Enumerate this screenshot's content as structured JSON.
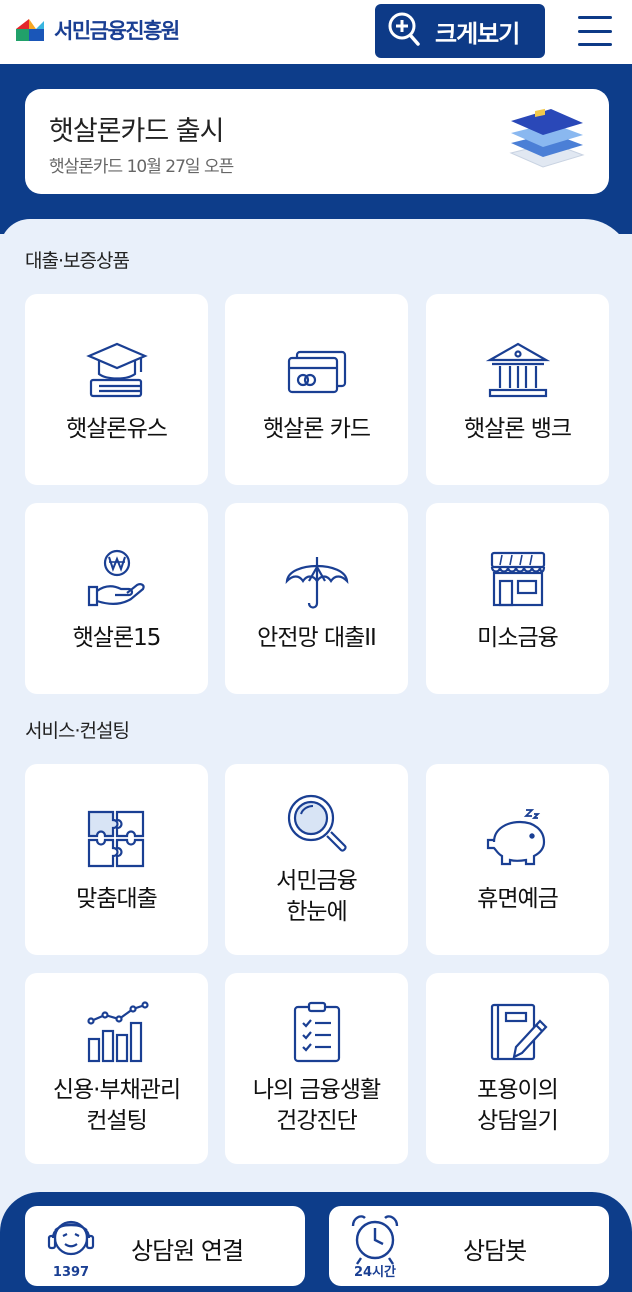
{
  "header": {
    "logo_text": "서민금융진흥원",
    "zoom_label": "크게보기"
  },
  "banner": {
    "title": "햇살론카드 출시",
    "subtitle": "햇살론카드 10월 27일 오픈"
  },
  "sections": {
    "loans_title": "대출·보증상품",
    "services_title": "서비스·컨설팅"
  },
  "loans": [
    {
      "label": "햇살론유스",
      "icon": "graduation-cap-icon"
    },
    {
      "label": "햇살론 카드",
      "icon": "credit-card-icon"
    },
    {
      "label": "햇살론 뱅크",
      "icon": "bank-building-icon"
    },
    {
      "label": "햇살론15",
      "icon": "hand-won-coin-icon"
    },
    {
      "label": "안전망 대출II",
      "icon": "umbrella-icon"
    },
    {
      "label": "미소금융",
      "icon": "storefront-icon"
    }
  ],
  "services": [
    {
      "label": "맞춤대출",
      "icon": "puzzle-icon"
    },
    {
      "label": "서민금융\n한눈에",
      "icon": "magnifier-icon"
    },
    {
      "label": "휴면예금",
      "icon": "piggy-bank-icon"
    },
    {
      "label": "신용·부채관리\n컨설팅",
      "icon": "bar-chart-icon"
    },
    {
      "label": "나의 금융생활\n건강진단",
      "icon": "checklist-clipboard-icon"
    },
    {
      "label": "포용이의\n상담일기",
      "icon": "notebook-pen-icon"
    }
  ],
  "bottom": {
    "counsel_label": "상담원 연결",
    "counsel_badge": "1397",
    "bot_label": "상담봇",
    "bot_badge": "24시간"
  },
  "colors": {
    "primary": "#0d3d8a",
    "background": "#e9f0fa",
    "icon_stroke": "#1a3f93"
  }
}
